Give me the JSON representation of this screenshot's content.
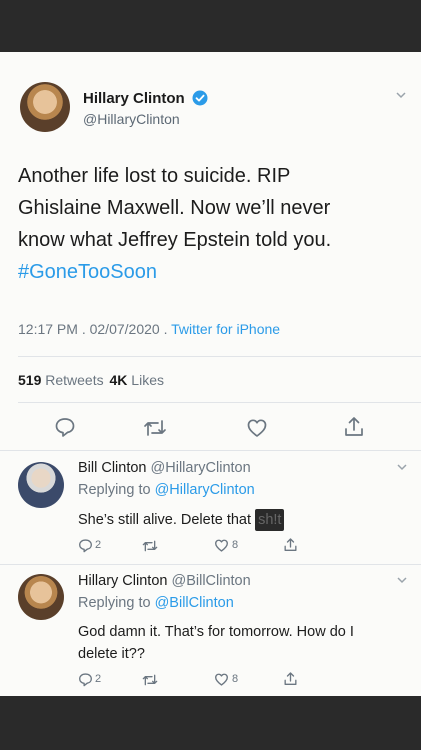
{
  "main_tweet": {
    "name": "Hillary Clinton",
    "handle": "@HillaryClinton",
    "text_line1": "Another life lost to suicide. RIP",
    "text_line2": "Ghislaine Maxwell. Now we’ll never",
    "text_line3": "know what Jeffrey Epstein told you.",
    "hashtag": "#GoneTooSoon",
    "time": "12:17 PM",
    "date_sep": ".",
    "date": "02/07/2020",
    "source_sep": ".",
    "source": "Twitter for iPhone",
    "retweet_count": "519",
    "retweet_label": "Retweets",
    "like_count": "4K",
    "like_label": "Likes"
  },
  "reply1": {
    "name": "Bill Clinton",
    "handle": "@HillaryClinton",
    "replying_prefix": "Replying to",
    "replying_to": "@HillaryClinton",
    "text": "She’s still alive. Delete that",
    "text_censored": "sh!t",
    "reply_count": "2",
    "like_count": "8"
  },
  "reply2": {
    "name": "Hillary Clinton",
    "handle": "@BillClinton",
    "replying_prefix": "Replying to",
    "replying_to": "@BillClinton",
    "text_line1": "God damn it. That’s for tomorrow. How do I",
    "text_line2": "delete it??",
    "reply_count": "2",
    "like_count": "8"
  },
  "colors": {
    "link_blue": "#2b9be8",
    "gray_text": "#6b7681",
    "frame_dark": "#2a2a2a",
    "card_bg": "#fbfbf9"
  },
  "icons": [
    "verified-badge-icon",
    "chevron-down-icon",
    "reply-icon",
    "retweet-icon",
    "like-icon",
    "share-icon"
  ]
}
